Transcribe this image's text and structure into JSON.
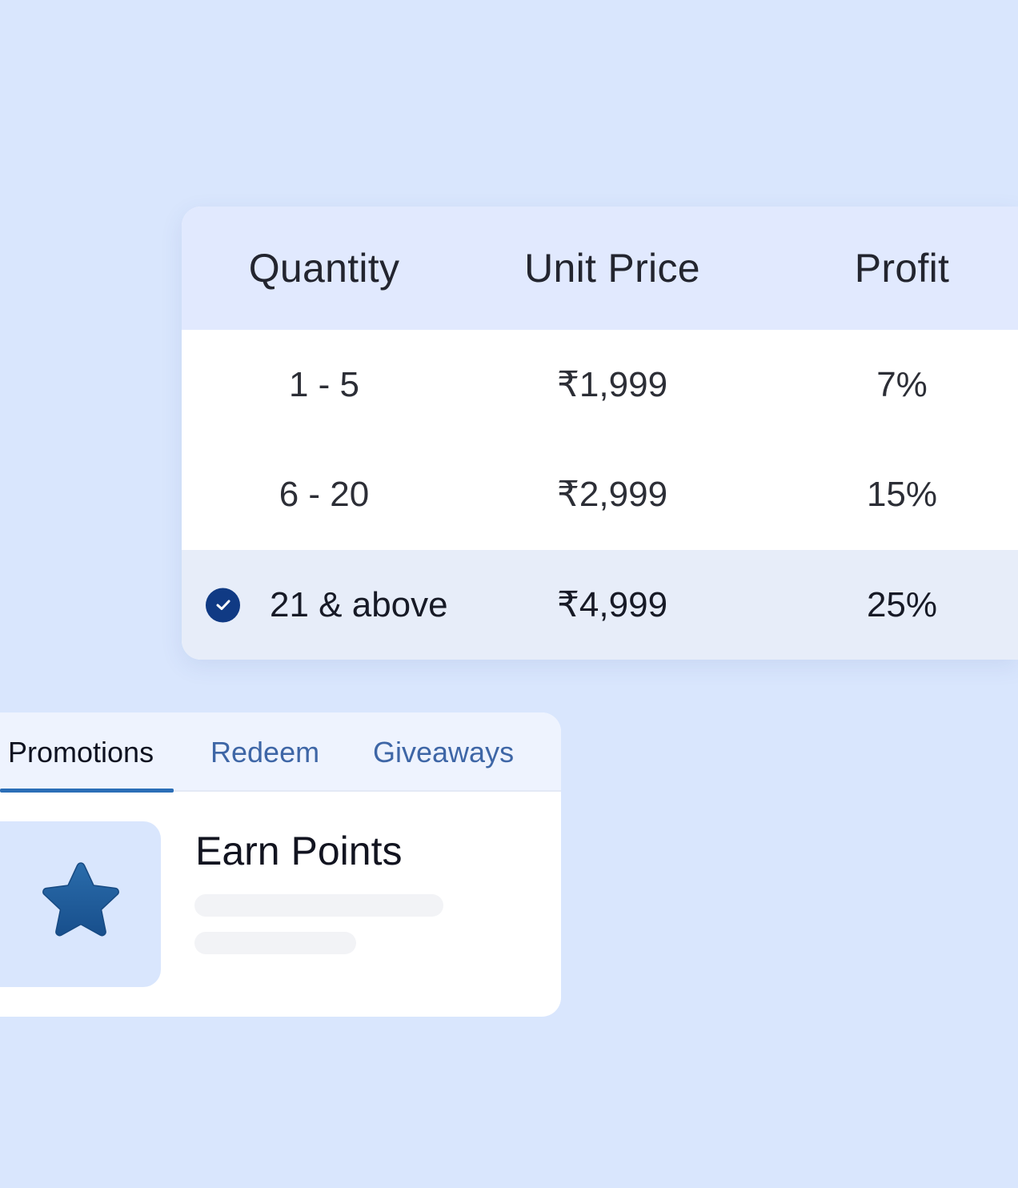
{
  "pricing_table": {
    "headers": [
      "Quantity",
      "Unit Price",
      "Profit"
    ],
    "rows": [
      {
        "quantity": "1 - 5",
        "unit_price": "₹1,999",
        "profit": "7%",
        "selected": false
      },
      {
        "quantity": "6 - 20",
        "unit_price": "₹2,999",
        "profit": "15%",
        "selected": false
      },
      {
        "quantity": "21 & above",
        "unit_price": "₹4,999",
        "profit": "25%",
        "selected": true
      }
    ]
  },
  "promotions": {
    "tabs": [
      {
        "label": "Promotions",
        "active": true
      },
      {
        "label": "Redeem",
        "active": false
      },
      {
        "label": "Giveaways",
        "active": false
      }
    ],
    "card": {
      "title": "Earn Points",
      "icon": "star-icon"
    }
  },
  "colors": {
    "background": "#d9e6fd",
    "table_header": "#e1e9fe",
    "selected_row": "#e7edf9",
    "check": "#103a84",
    "tab_accent": "#2b6eb7",
    "star": "#1f5d9c"
  }
}
